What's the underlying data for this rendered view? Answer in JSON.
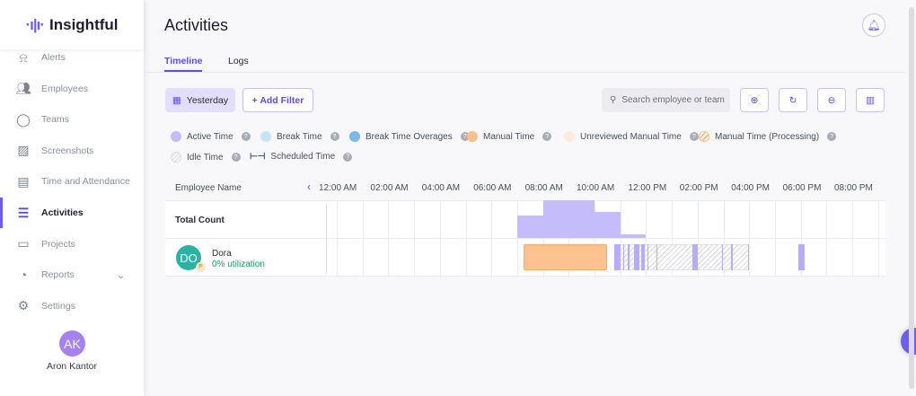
{
  "app": {
    "name": "Insightful"
  },
  "sidebar": {
    "items": [
      {
        "label": "Alerts",
        "icon": "bell-icon"
      },
      {
        "label": "Employees",
        "icon": "users-icon"
      },
      {
        "label": "Teams",
        "icon": "teams-icon"
      },
      {
        "label": "Screenshots",
        "icon": "images-icon"
      },
      {
        "label": "Time and Attendance",
        "icon": "calendar-icon"
      },
      {
        "label": "Activities",
        "icon": "list-icon",
        "active": true
      },
      {
        "label": "Projects",
        "icon": "briefcase-icon"
      },
      {
        "label": "Reports",
        "icon": "chart-pie-icon"
      },
      {
        "label": "Settings",
        "icon": "gear-icon"
      }
    ],
    "user": {
      "initials": "AK",
      "name": "Aron Kantor"
    }
  },
  "page": {
    "title": "Activities",
    "tabs": [
      "Timeline",
      "Logs"
    ],
    "active_tab": "Timeline"
  },
  "toolbar": {
    "date": "Yesterday",
    "add_filter": "+ Add Filter",
    "search_placeholder": "Search employee or team"
  },
  "legend": [
    {
      "label": "Active Time",
      "color": "#c5bcfb"
    },
    {
      "label": "Break Time",
      "color": "#c6e3f8"
    },
    {
      "label": "Break Time Overages",
      "color": "#79b9ea"
    },
    {
      "label": "Manual Time",
      "color": "#fbbf88"
    },
    {
      "label": "Unreviewed Manual Time",
      "color": "#fdeadb"
    },
    {
      "label": "Manual Time (Processing)",
      "color": "hatched-orange"
    },
    {
      "label": "Idle Time",
      "color": "hatched-gray"
    },
    {
      "label": "Scheduled Time",
      "color": "#3b3fc9"
    }
  ],
  "timeline": {
    "column_header": "Employee Name",
    "hours": [
      "12:00 AM",
      "02:00 AM",
      "04:00 AM",
      "06:00 AM",
      "08:00 AM",
      "10:00 AM",
      "12:00 PM",
      "02:00 PM",
      "04:00 PM",
      "06:00 PM",
      "08:00 PM"
    ],
    "total_label": "Total Count",
    "total_profile": [
      {
        "from": 7,
        "to": 8,
        "level": 0.6
      },
      {
        "from": 8,
        "to": 10,
        "level": 1
      },
      {
        "from": 10,
        "to": 11,
        "level": 0.7
      },
      {
        "from": 11,
        "to": 12,
        "level": 0.1
      }
    ],
    "employee": {
      "initials": "DO",
      "badge": "P",
      "name": "Dora",
      "utilization": "0% utilization",
      "manual": [
        [
          7.25,
          10.5
        ]
      ],
      "idle": [
        [
          10.75,
          16
        ]
      ],
      "active": [
        [
          10.75,
          11.0
        ],
        [
          11.1,
          11.15
        ],
        [
          11.3,
          11.35
        ],
        [
          11.55,
          11.75
        ],
        [
          11.8,
          11.95
        ],
        [
          12.05,
          12.1
        ],
        [
          12.4,
          12.45
        ],
        [
          13.8,
          14.0
        ],
        [
          14.95,
          15.0
        ],
        [
          15.3,
          15.35
        ],
        [
          15.95,
          16.0
        ],
        [
          17.9,
          18.15
        ]
      ]
    }
  }
}
